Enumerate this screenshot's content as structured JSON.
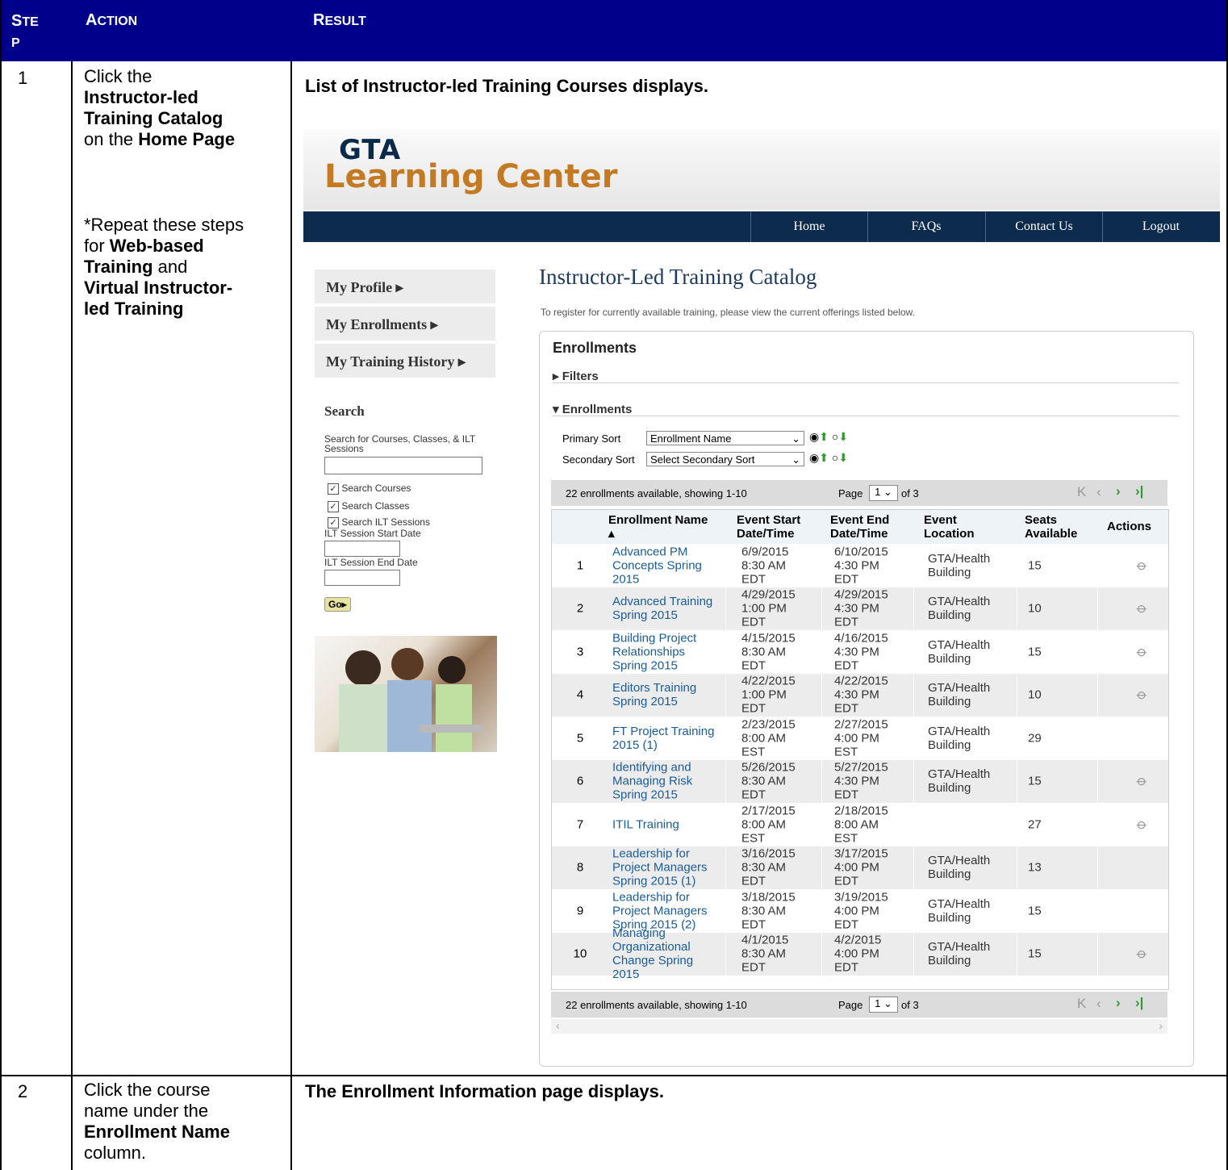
{
  "table": {
    "headers": {
      "step": "STE\nP",
      "action": "ACTION",
      "result": "RESULT"
    },
    "rows": [
      {
        "step": "1",
        "action_lines": [
          "Click the",
          "Instructor-led",
          "Training Catalog",
          "on the Home Page"
        ],
        "action_note": [
          "*Repeat these steps",
          "for Web-based",
          "Training and",
          "Virtual Instructor-",
          "led Training"
        ],
        "result": "List of Instructor-led Training Courses displays."
      },
      {
        "step": "2",
        "action_lines": [
          "Click the course",
          "name under the",
          "Enrollment Name",
          "column."
        ],
        "result": "The Enrollment Information page displays."
      }
    ]
  },
  "screenshot": {
    "logo_top": "GTA",
    "logo_bottom": "Learning Center",
    "nav": [
      "Home",
      "FAQs",
      "Contact Us",
      "Logout"
    ],
    "sidebar": [
      "My Profile ▸",
      "My Enrollments ▸",
      "My Training History ▸"
    ],
    "search": {
      "title": "Search",
      "label": "Search for Courses, Classes, & ILT Sessions",
      "checkboxes": [
        "Search Courses",
        "Search Classes",
        "Search ILT Sessions"
      ],
      "start_label": "ILT Session Start Date",
      "end_label": "ILT Session End Date",
      "go": "Go▸"
    },
    "page_title": "Instructor-Led Training Catalog",
    "intro": "To register for currently available training, please view the current offerings listed below.",
    "panel_title": "Enrollments",
    "filters_label": "Filters",
    "enrollments_label": "Enrollments",
    "primary_sort_label": "Primary Sort",
    "primary_sort_value": "Enrollment Name",
    "secondary_sort_label": "Secondary Sort",
    "secondary_sort_value": "Select Secondary Sort",
    "pager": {
      "summary": "22 enrollments available, showing 1-10",
      "page_label": "Page",
      "page_value": "1",
      "of_label": "of 3"
    },
    "columns": [
      "Enrollment Name ▴",
      "Event Start Date/Time",
      "Event End Date/Time",
      "Event Location",
      "Seats Available",
      "Actions"
    ],
    "rows": [
      {
        "n": "1",
        "name": "Advanced PM Concepts Spring 2015",
        "start": "6/9/2015 8:30 AM EDT",
        "end": "6/10/2015 4:30 PM EDT",
        "loc": "GTA/Health Building",
        "seats": "15",
        "clip": true
      },
      {
        "n": "2",
        "name": "Advanced Training Spring 2015",
        "start": "4/29/2015 1:00 PM EDT",
        "end": "4/29/2015 4:30 PM EDT",
        "loc": "GTA/Health Building",
        "seats": "10",
        "clip": true
      },
      {
        "n": "3",
        "name": "Building Project Relationships Spring 2015",
        "start": "4/15/2015 8:30 AM EDT",
        "end": "4/16/2015 4:30 PM EDT",
        "loc": "GTA/Health Building",
        "seats": "15",
        "clip": true
      },
      {
        "n": "4",
        "name": "Editors Training Spring 2015",
        "start": "4/22/2015 1:00 PM EDT",
        "end": "4/22/2015 4:30 PM EDT",
        "loc": "GTA/Health Building",
        "seats": "10",
        "clip": true
      },
      {
        "n": "5",
        "name": "FT Project Training 2015 (1)",
        "start": "2/23/2015 8:00 AM EST",
        "end": "2/27/2015 4:00 PM EST",
        "loc": "GTA/Health Building",
        "seats": "29",
        "clip": false
      },
      {
        "n": "6",
        "name": "Identifying and Managing Risk Spring 2015",
        "start": "5/26/2015 8:30 AM EDT",
        "end": "5/27/2015 4:30 PM EDT",
        "loc": "GTA/Health Building",
        "seats": "15",
        "clip": true
      },
      {
        "n": "7",
        "name": "ITIL Training",
        "start": "2/17/2015 8:00 AM EST",
        "end": "2/18/2015 8:00 AM EST",
        "loc": "",
        "seats": "27",
        "clip": true
      },
      {
        "n": "8",
        "name": "Leadership for Project Managers Spring 2015 (1)",
        "start": "3/16/2015 8:30 AM EDT",
        "end": "3/17/2015 4:00 PM EDT",
        "loc": "GTA/Health Building",
        "seats": "13",
        "clip": false
      },
      {
        "n": "9",
        "name": "Leadership for Project Managers Spring 2015 (2)",
        "start": "3/18/2015 8:30 AM EDT",
        "end": "3/19/2015 4:00 PM EDT",
        "loc": "GTA/Health Building",
        "seats": "15",
        "clip": false
      },
      {
        "n": "10",
        "name": "Managing Organizational Change Spring 2015",
        "start": "4/1/2015 8:30 AM EDT",
        "end": "4/2/2015 4:00 PM EDT",
        "loc": "GTA/Health Building",
        "seats": "15",
        "clip": true
      }
    ]
  }
}
